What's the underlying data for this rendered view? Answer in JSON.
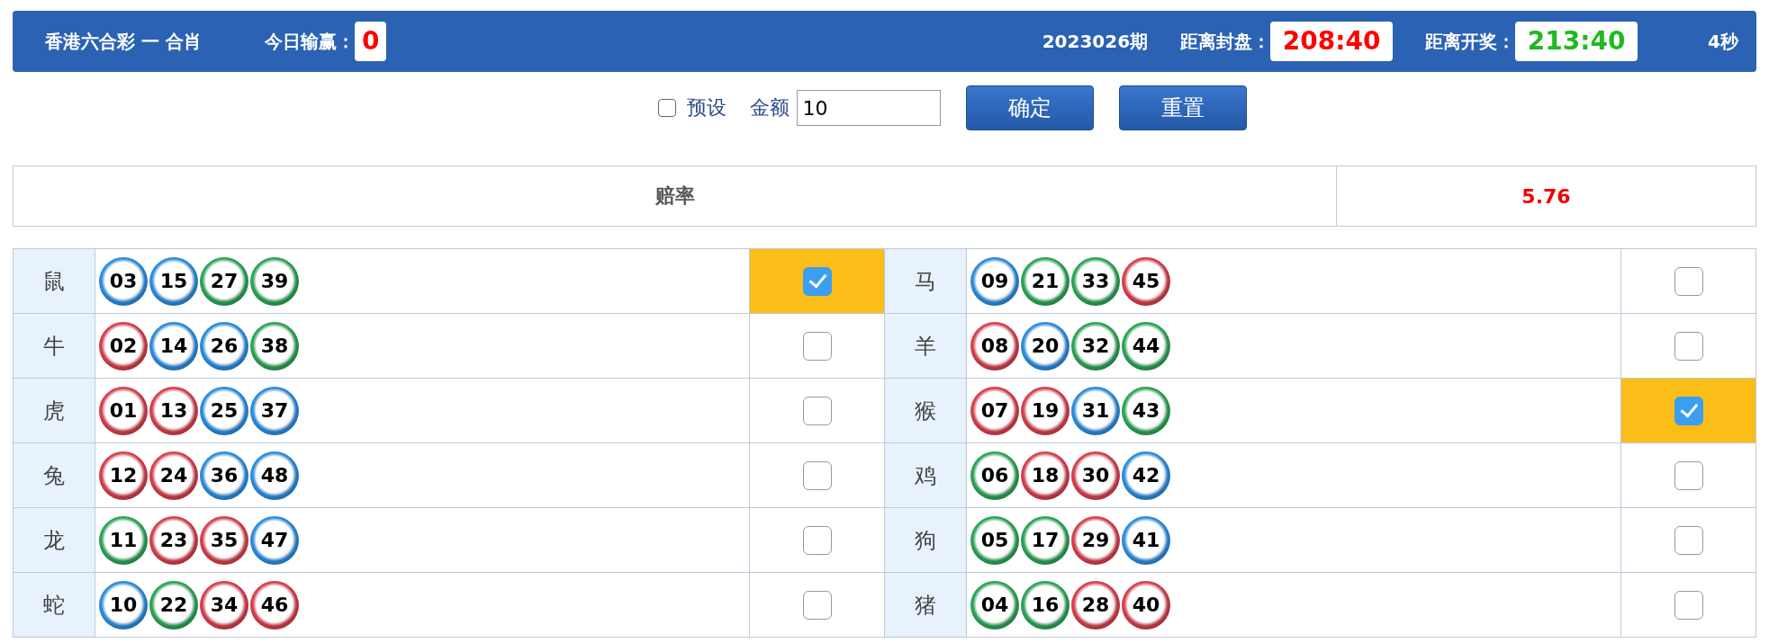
{
  "header": {
    "title": "香港六合彩 一 合肖",
    "today_label": "今日输赢：",
    "today_value": "0",
    "period": "2023026期",
    "timers": [
      {
        "label": "距离封盘：",
        "value": "208:40",
        "color": "#ff0000"
      },
      {
        "label": "距离开奖：",
        "value": "213:40",
        "color": "#22b822"
      }
    ],
    "refresh": "4秒"
  },
  "controls": {
    "preset": {
      "label": "预设",
      "checked": false
    },
    "amount": {
      "label": "金额",
      "value": "10"
    },
    "buttons": [
      "确定",
      "重置"
    ]
  },
  "odds": {
    "label": "赔率",
    "value": "5.76"
  },
  "zodiacs": [
    {
      "name": "鼠",
      "checked": true,
      "balls": [
        {
          "number": "03",
          "color": "#2e8fe0"
        },
        {
          "number": "15",
          "color": "#2e8fe0"
        },
        {
          "number": "27",
          "color": "#2fa65a"
        },
        {
          "number": "39",
          "color": "#2fa65a"
        }
      ]
    },
    {
      "name": "马",
      "checked": false,
      "balls": [
        {
          "number": "09",
          "color": "#2e8fe0"
        },
        {
          "number": "21",
          "color": "#2fa65a"
        },
        {
          "number": "33",
          "color": "#2fa65a"
        },
        {
          "number": "45",
          "color": "#d9414f"
        }
      ]
    },
    {
      "name": "牛",
      "checked": false,
      "balls": [
        {
          "number": "02",
          "color": "#d9414f"
        },
        {
          "number": "14",
          "color": "#2e8fe0"
        },
        {
          "number": "26",
          "color": "#2e8fe0"
        },
        {
          "number": "38",
          "color": "#2fa65a"
        }
      ]
    },
    {
      "name": "羊",
      "checked": false,
      "balls": [
        {
          "number": "08",
          "color": "#d9414f"
        },
        {
          "number": "20",
          "color": "#2e8fe0"
        },
        {
          "number": "32",
          "color": "#2fa65a"
        },
        {
          "number": "44",
          "color": "#2fa65a"
        }
      ]
    },
    {
      "name": "虎",
      "checked": false,
      "balls": [
        {
          "number": "01",
          "color": "#d9414f"
        },
        {
          "number": "13",
          "color": "#d9414f"
        },
        {
          "number": "25",
          "color": "#2e8fe0"
        },
        {
          "number": "37",
          "color": "#2e8fe0"
        }
      ]
    },
    {
      "name": "猴",
      "checked": true,
      "balls": [
        {
          "number": "07",
          "color": "#d9414f"
        },
        {
          "number": "19",
          "color": "#d9414f"
        },
        {
          "number": "31",
          "color": "#2e8fe0"
        },
        {
          "number": "43",
          "color": "#2fa65a"
        }
      ]
    },
    {
      "name": "兔",
      "checked": false,
      "balls": [
        {
          "number": "12",
          "color": "#d9414f"
        },
        {
          "number": "24",
          "color": "#d9414f"
        },
        {
          "number": "36",
          "color": "#2e8fe0"
        },
        {
          "number": "48",
          "color": "#2e8fe0"
        }
      ]
    },
    {
      "name": "鸡",
      "checked": false,
      "balls": [
        {
          "number": "06",
          "color": "#2fa65a"
        },
        {
          "number": "18",
          "color": "#d9414f"
        },
        {
          "number": "30",
          "color": "#d9414f"
        },
        {
          "number": "42",
          "color": "#2e8fe0"
        }
      ]
    },
    {
      "name": "龙",
      "checked": false,
      "balls": [
        {
          "number": "11",
          "color": "#2fa65a"
        },
        {
          "number": "23",
          "color": "#d9414f"
        },
        {
          "number": "35",
          "color": "#d9414f"
        },
        {
          "number": "47",
          "color": "#2e8fe0"
        }
      ]
    },
    {
      "name": "狗",
      "checked": false,
      "balls": [
        {
          "number": "05",
          "color": "#2fa65a"
        },
        {
          "number": "17",
          "color": "#2fa65a"
        },
        {
          "number": "29",
          "color": "#d9414f"
        },
        {
          "number": "41",
          "color": "#2e8fe0"
        }
      ]
    },
    {
      "name": "蛇",
      "checked": false,
      "balls": [
        {
          "number": "10",
          "color": "#2e8fe0"
        },
        {
          "number": "22",
          "color": "#2fa65a"
        },
        {
          "number": "34",
          "color": "#d9414f"
        },
        {
          "number": "46",
          "color": "#d9414f"
        }
      ]
    },
    {
      "name": "猪",
      "checked": false,
      "balls": [
        {
          "number": "04",
          "color": "#2fa65a"
        },
        {
          "number": "16",
          "color": "#2fa65a"
        },
        {
          "number": "28",
          "color": "#d9414f"
        },
        {
          "number": "40",
          "color": "#d9414f"
        }
      ]
    }
  ]
}
